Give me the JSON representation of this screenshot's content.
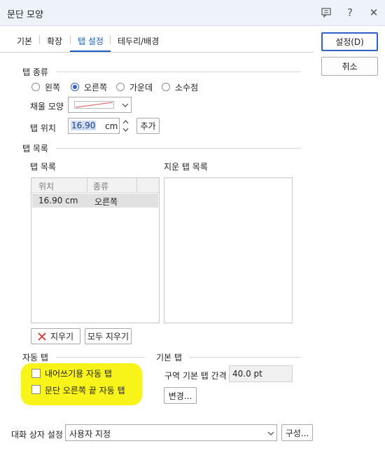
{
  "window": {
    "title": "문단 모양",
    "help_label": "?",
    "close_label": "✕"
  },
  "tabs": [
    "기본",
    "확장",
    "탭 설정",
    "테두리/배경"
  ],
  "buttons": {
    "ok": "설정(D)",
    "cancel": "취소"
  },
  "tab_kind": {
    "title": "탭 종류",
    "options": [
      "왼쪽",
      "오른쪽",
      "가운데",
      "소수점"
    ],
    "selected": "오른쪽"
  },
  "fill": {
    "label": "채울 모양"
  },
  "position": {
    "label": "탭 위치",
    "value": "16.90",
    "unit": "cm",
    "add_label": "추가"
  },
  "tab_list": {
    "section_title": "탭 목록",
    "list_label": "탭 목록",
    "columns": [
      "위치",
      "종류"
    ],
    "rows": [
      {
        "pos": "16.90 cm",
        "kind": "오른쪽"
      }
    ],
    "deleted_label": "지운 탭 목록",
    "delete_label": "지우기",
    "delete_all_label": "모두 지우기"
  },
  "auto_tab": {
    "title": "자동 탭",
    "items": [
      "내어쓰기용 자동 탭",
      "문단 오른쪽 끝 자동 탭"
    ]
  },
  "basic_tab": {
    "title": "기본 탭",
    "gap_label": "구역 기본 탭 간격",
    "gap_value": "40.0 pt",
    "change_label": "변경..."
  },
  "dialog_settings": {
    "label": "대화 상자 설정",
    "value": "사용자 지정",
    "config_label": "구성..."
  },
  "colors": {
    "accent": "#2f62c9",
    "highlight": "#f7f300",
    "fill_line": "#d9534f"
  }
}
